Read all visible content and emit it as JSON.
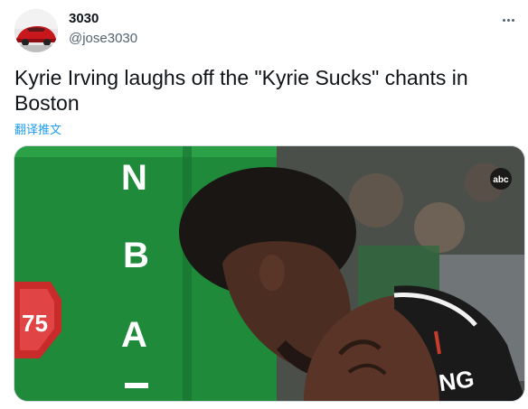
{
  "user": {
    "display_name": "3030",
    "handle": "@jose3030",
    "avatar_icon": "red-car-avatar"
  },
  "tweet": {
    "text": "Kyrie Irving laughs off the \"Kyrie Sucks\" chants in Boston",
    "translate_label": "翻译推文"
  },
  "media": {
    "network_badge": "abc",
    "league_letters": [
      "N",
      "B",
      "A"
    ],
    "anniversary_label": "75",
    "jersey_text": "NG"
  },
  "colors": {
    "link": "#1d9bf0",
    "secondary_text": "#536471",
    "court_green": "#1f8a3a",
    "jersey_black": "#1a1a1a"
  },
  "menu": {
    "icon": "more-options-icon"
  }
}
